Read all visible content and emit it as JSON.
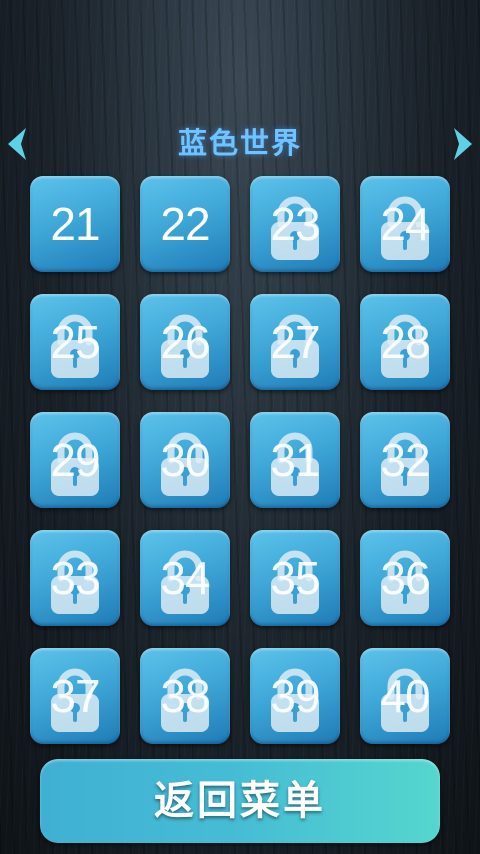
{
  "header": {
    "title": "蓝色世界",
    "prev_icon": "chevron-left-icon",
    "next_icon": "chevron-right-icon",
    "arrow_color": "#5fd0e6"
  },
  "levels": [
    {
      "number": "21",
      "locked": false
    },
    {
      "number": "22",
      "locked": false
    },
    {
      "number": "23",
      "locked": true
    },
    {
      "number": "24",
      "locked": true
    },
    {
      "number": "25",
      "locked": true
    },
    {
      "number": "26",
      "locked": true
    },
    {
      "number": "27",
      "locked": true
    },
    {
      "number": "28",
      "locked": true
    },
    {
      "number": "29",
      "locked": true
    },
    {
      "number": "30",
      "locked": true
    },
    {
      "number": "31",
      "locked": true
    },
    {
      "number": "32",
      "locked": true
    },
    {
      "number": "33",
      "locked": true
    },
    {
      "number": "34",
      "locked": true
    },
    {
      "number": "35",
      "locked": true
    },
    {
      "number": "36",
      "locked": true
    },
    {
      "number": "37",
      "locked": true
    },
    {
      "number": "38",
      "locked": true
    },
    {
      "number": "39",
      "locked": true
    },
    {
      "number": "40",
      "locked": true
    }
  ],
  "lock_icon": "padlock-icon",
  "menu_button": {
    "label": "返回菜单"
  }
}
